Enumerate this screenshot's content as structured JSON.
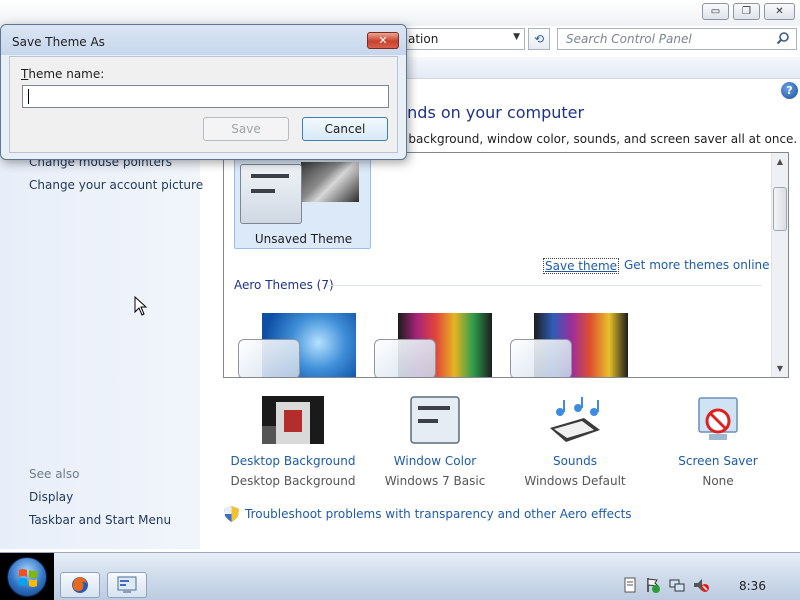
{
  "window": {
    "controls": {
      "minimize": "▭",
      "maximize": "❐",
      "close": "✕"
    },
    "address": {
      "text": "ation",
      "dropdown": "▼"
    },
    "refresh": "⟲",
    "search": {
      "placeholder": "Search Control Panel",
      "icon": "search-icon"
    }
  },
  "left_pane": {
    "links": [
      "Change mouse pointers",
      "Change your account picture"
    ],
    "see_also_title": "See also",
    "see_also_links": [
      "Display",
      "Taskbar and Start Menu"
    ]
  },
  "main": {
    "help": "?",
    "heading": "unds on your computer",
    "subheading": "p background, window color, sounds, and screen saver all at once.",
    "unsaved_theme_label": "Unsaved Theme",
    "save_theme_link": "Save theme",
    "more_themes_link": "Get more themes online",
    "aero_header": "Aero Themes (7)",
    "scroll": {
      "up": "▲",
      "down": "▼"
    },
    "customize": [
      {
        "label": "Desktop Background",
        "value": "Desktop Background",
        "icon": "desktop-background-icon"
      },
      {
        "label": "Window Color",
        "value": "Windows 7 Basic",
        "icon": "window-color-icon"
      },
      {
        "label": "Sounds",
        "value": "Windows Default",
        "icon": "sounds-icon"
      },
      {
        "label": "Screen Saver",
        "value": "None",
        "icon": "screen-saver-icon"
      }
    ],
    "troubleshoot_link": "Troubleshoot problems with transparency and other Aero effects"
  },
  "dialog": {
    "title": "Save Theme As",
    "close": "✕",
    "label_mnemonic": "T",
    "label_rest": "heme name:",
    "input_value": "",
    "save_button": "Save",
    "cancel_button": "Cancel"
  },
  "taskbar": {
    "clock": "8:36",
    "apps": [
      "firefox-icon",
      "control-panel-icon"
    ]
  },
  "colors": {
    "link": "#1e5ba8",
    "heading": "#1e3287",
    "close_red": "#c8412d"
  }
}
